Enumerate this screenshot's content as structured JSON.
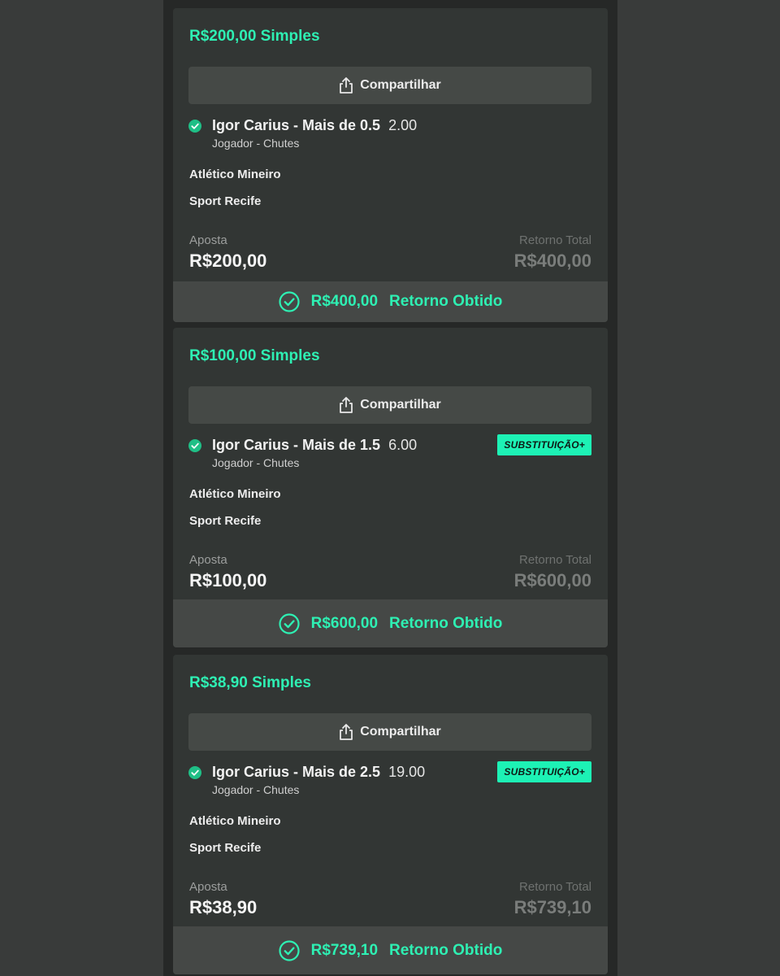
{
  "share_label": "Compartilhar",
  "colors": {
    "accent": "#2ef0b3",
    "promo_bg": "#1df2b5"
  },
  "bets": [
    {
      "title": "R$200,00 Simples",
      "selection": "Igor Carius - Mais de 0.5",
      "odds": "2.00",
      "market": "Jogador - Chutes",
      "promo": null,
      "team_home": "Atlético Mineiro",
      "team_away": "Sport Recife",
      "stake_label": "Aposta",
      "stake": "R$200,00",
      "return_label": "Retorno Total",
      "return": "R$400,00",
      "footer_amount": "R$400,00",
      "footer_label": "Retorno Obtido"
    },
    {
      "title": "R$100,00 Simples",
      "selection": "Igor Carius - Mais de 1.5",
      "odds": "6.00",
      "market": "Jogador - Chutes",
      "promo": "SUBSTITUIÇÃO+",
      "team_home": "Atlético Mineiro",
      "team_away": "Sport Recife",
      "stake_label": "Aposta",
      "stake": "R$100,00",
      "return_label": "Retorno Total",
      "return": "R$600,00",
      "footer_amount": "R$600,00",
      "footer_label": "Retorno Obtido"
    },
    {
      "title": "R$38,90 Simples",
      "selection": "Igor Carius - Mais de 2.5",
      "odds": "19.00",
      "market": "Jogador - Chutes",
      "promo": "SUBSTITUIÇÃO+",
      "team_home": "Atlético Mineiro",
      "team_away": "Sport Recife",
      "stake_label": "Aposta",
      "stake": "R$38,90",
      "return_label": "Retorno Total",
      "return": "R$739,10",
      "footer_amount": "R$739,10",
      "footer_label": "Retorno Obtido"
    }
  ]
}
